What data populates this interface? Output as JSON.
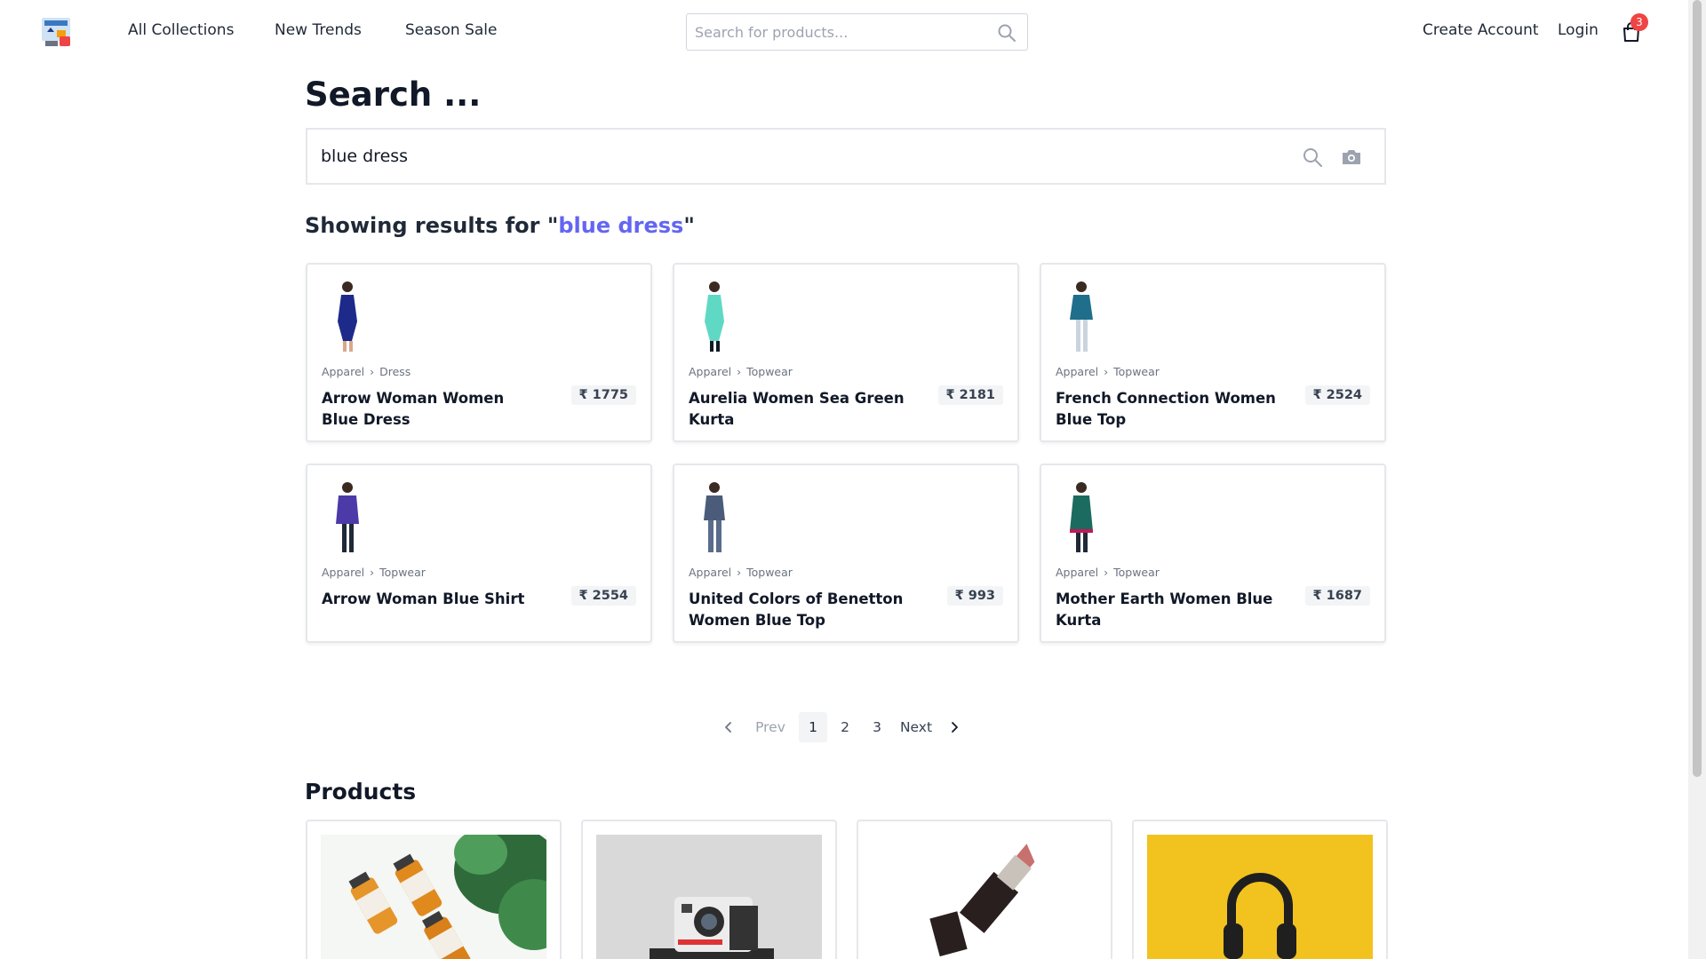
{
  "nav": {
    "links": [
      "All Collections",
      "New Trends",
      "Season Sale"
    ],
    "search_placeholder": "Search for products...",
    "create_account": "Create Account",
    "login": "Login",
    "cart_count": "3"
  },
  "main": {
    "title": "Search ...",
    "search_value": "blue dress",
    "results_prefix": "Showing results for \"",
    "results_query": "blue dress",
    "results_suffix": "\""
  },
  "results": [
    {
      "category": "Apparel",
      "subcategory": "Dress",
      "name": "Arrow Woman Women Blue Dress",
      "price": "₹ 1775",
      "color": "#1e2a8a"
    },
    {
      "category": "Apparel",
      "subcategory": "Topwear",
      "name": "Aurelia Women Sea Green Kurta",
      "price": "₹ 2181",
      "color": "#5fd9c3"
    },
    {
      "category": "Apparel",
      "subcategory": "Topwear",
      "name": "French Connection Women Blue Top",
      "price": "₹ 2524",
      "color": "#1f6e8c"
    },
    {
      "category": "Apparel",
      "subcategory": "Topwear",
      "name": "Arrow Woman Blue Shirt",
      "price": "₹ 2554",
      "color": "#4c3aa8"
    },
    {
      "category": "Apparel",
      "subcategory": "Topwear",
      "name": "United Colors of Benetton Women Blue Top",
      "price": "₹ 993",
      "color": "#4b5c7a"
    },
    {
      "category": "Apparel",
      "subcategory": "Topwear",
      "name": "Mother Earth Women Blue Kurta",
      "price": "₹ 1687",
      "color": "#1b6b60"
    }
  ],
  "pagination": {
    "prev": "Prev",
    "pages": [
      "1",
      "2",
      "3"
    ],
    "current": "1",
    "next": "Next"
  },
  "products": {
    "title": "Products",
    "items": [
      {
        "icon": "juice-bottles-image"
      },
      {
        "icon": "instant-camera-image"
      },
      {
        "icon": "lipstick-image"
      },
      {
        "icon": "headphones-image"
      }
    ]
  },
  "colors": {
    "accent": "#6366f1",
    "badge": "#ef4444"
  }
}
